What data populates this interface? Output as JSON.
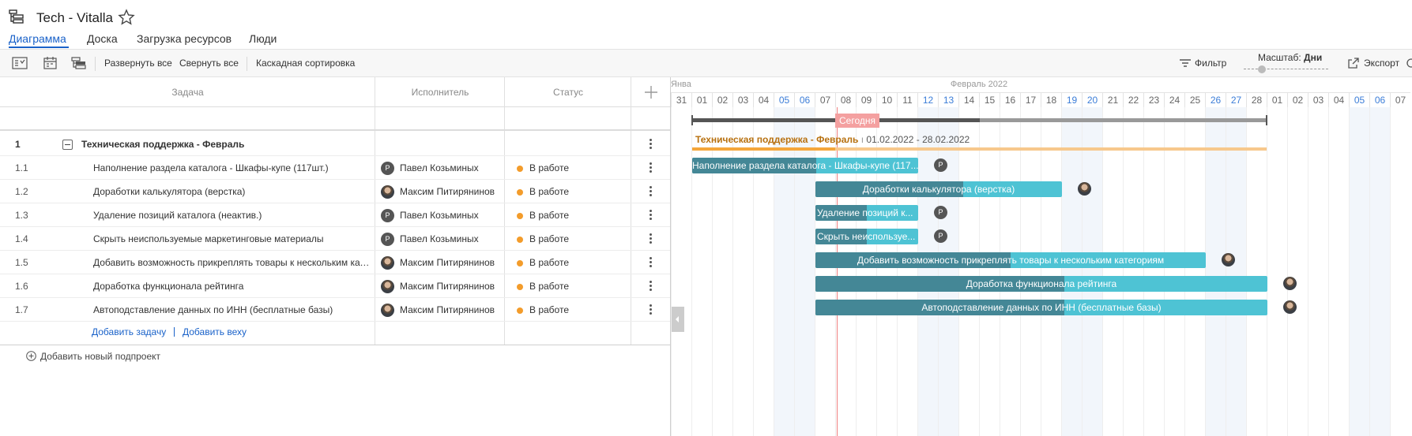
{
  "project": {
    "title": "Tech - Vitalla"
  },
  "tabs": [
    {
      "label": "Диаграмма"
    },
    {
      "label": "Доска"
    },
    {
      "label": "Загрузка ресурсов"
    },
    {
      "label": "Люди"
    }
  ],
  "toolbar": {
    "expand_all": "Развернуть все",
    "collapse_all": "Свернуть все",
    "cascade_sort": "Каскадная сортировка",
    "filter": "Фильтр",
    "scale_label": "Масштаб:",
    "scale_value": "Дни",
    "export": "Экспорт"
  },
  "columns": {
    "task": "Задача",
    "assignee": "Исполнитель",
    "status": "Статус"
  },
  "group": {
    "num": "1",
    "name": "Техническая поддержка - Февраль"
  },
  "tasks": [
    {
      "num": "1.1",
      "name": "Наполнение раздела каталога - Шкафы-купе (117шт.)",
      "assignee": "Павел Козьминых",
      "initial": "Р",
      "status": "В работе"
    },
    {
      "num": "1.2",
      "name": "Доработки калькулятора (верстка)",
      "assignee": "Максим Питирянинов",
      "initial": "",
      "status": "В работе"
    },
    {
      "num": "1.3",
      "name": "Удаление позиций каталога (неактив.)",
      "assignee": "Павел Козьминых",
      "initial": "Р",
      "status": "В работе"
    },
    {
      "num": "1.4",
      "name": "Скрыть неиспользуемые маркетинговые материалы",
      "assignee": "Павел Козьминых",
      "initial": "Р",
      "status": "В работе"
    },
    {
      "num": "1.5",
      "name": "Добавить возможность прикреплять товары к нескольким категориям",
      "assignee": "Максим Питирянинов",
      "initial": "",
      "status": "В работе"
    },
    {
      "num": "1.6",
      "name": "Доработка функционала рейтинга",
      "assignee": "Максим Питирянинов",
      "initial": "",
      "status": "В работе"
    },
    {
      "num": "1.7",
      "name": "Автоподставление данных по ИНН (бесплатные базы)",
      "assignee": "Максим Питирянинов",
      "initial": "",
      "status": "В работе"
    }
  ],
  "links": {
    "add_task": "Добавить задачу",
    "add_milestone": "Добавить веху",
    "add_subproject": "Добавить новый подпроект"
  },
  "gantt": {
    "month_prev": "Янва",
    "month_current": "Февраль 2022",
    "days": [
      "31",
      "01",
      "02",
      "03",
      "04",
      "05",
      "06",
      "07",
      "08",
      "09",
      "10",
      "11",
      "12",
      "13",
      "14",
      "15",
      "16",
      "17",
      "18",
      "19",
      "20",
      "21",
      "22",
      "23",
      "24",
      "25",
      "26",
      "27",
      "28",
      "01",
      "02",
      "03",
      "04",
      "05",
      "06",
      "07"
    ],
    "weekend_index": [
      5,
      6,
      12,
      13,
      19,
      20,
      26,
      27,
      33,
      34
    ],
    "today_label": "Сегодня",
    "today_index": 8,
    "group_label": "Техническая поддержка - Февраль",
    "group_dates": "01.02.2022 - 28.02.2022",
    "bars": [
      {
        "label": "Наполнение раздела каталога - Шкафы-купе (117...",
        "start": 1,
        "end": 12,
        "progress": 0.55
      },
      {
        "label": "Доработки калькулятора (верстка)",
        "start": 7,
        "end": 19,
        "progress": 0.6
      },
      {
        "label": "Удаление позиций к...",
        "start": 7,
        "end": 12,
        "progress": 0.5
      },
      {
        "label": "Скрыть неиспользуе...",
        "start": 7,
        "end": 12,
        "progress": 0.5
      },
      {
        "label": "Добавить возможность прикреплять товары к нескольким категориям",
        "start": 7,
        "end": 26,
        "progress": 0.5
      },
      {
        "label": "Доработка функционала рейтинга",
        "start": 7,
        "end": 29,
        "progress": 0.55
      },
      {
        "label": "Автоподставление данных по ИНН (бесплатные базы)",
        "start": 7,
        "end": 29,
        "progress": 0.55
      }
    ]
  },
  "colors": {
    "accent": "#1a62c9",
    "bar": "#4ec3d4",
    "bar_progress": "#448796",
    "today": "#f08080",
    "group_bar": "#f7b85c",
    "status_dot": "#f39c2b"
  }
}
